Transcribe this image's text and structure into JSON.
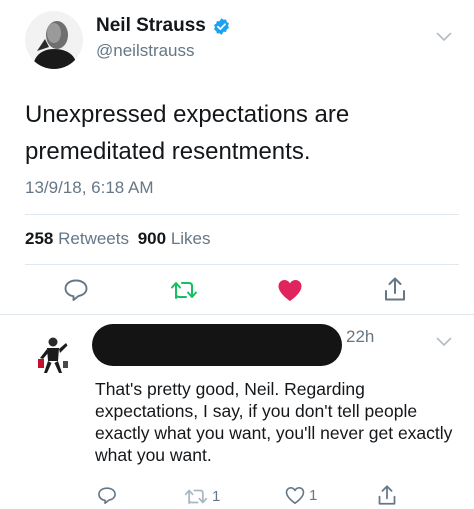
{
  "tweet": {
    "author_name": "Neil Strauss",
    "author_handle": "@neilstrauss",
    "text": "Unexpressed expectations are premeditated resentments.",
    "timestamp": "13/9/18, 6:18 AM",
    "retweets_count": "258",
    "retweets_label": "Retweets",
    "likes_count": "900",
    "likes_label": "Likes",
    "verified": true,
    "liked": true,
    "icons": [
      "reply-icon",
      "retweet-icon",
      "heart-icon",
      "share-icon",
      "chevron-down-icon",
      "verified-badge-icon"
    ],
    "colors": {
      "verified": "#1da1f2",
      "retweet": "#17bf63",
      "like": "#e0245e",
      "muted": "#657786"
    }
  },
  "reply": {
    "time": "22h",
    "text": "That's pretty good, Neil. Regarding expectations, I say, if you don't tell people exactly what you want, you'll never get exactly what you want.",
    "retweet_count": "1",
    "like_count": "1",
    "icons": [
      "reply-icon",
      "retweet-icon",
      "heart-outline-icon",
      "share-icon"
    ]
  }
}
